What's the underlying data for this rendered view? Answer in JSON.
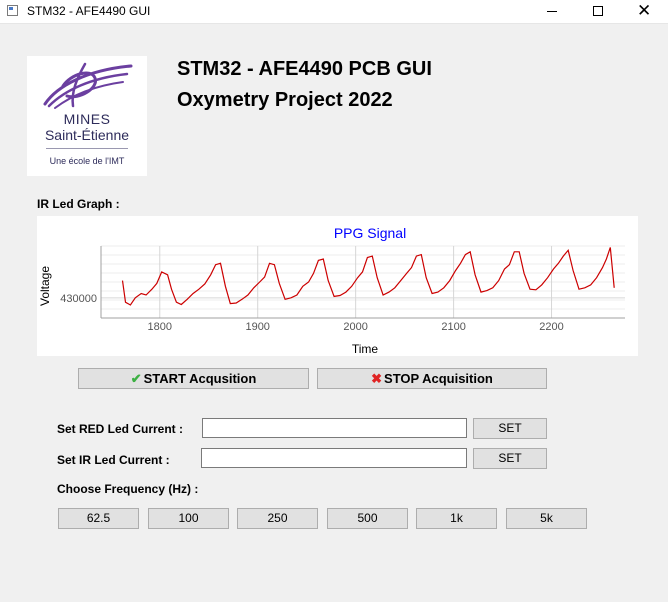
{
  "window": {
    "title": "STM32 - AFE4490 GUI"
  },
  "logo": {
    "line1": "MINES",
    "line2": "Saint-Étienne",
    "line3": "Une école de l'IMT"
  },
  "header": {
    "title_line1": "STM32 - AFE4490 PCB GUI",
    "title_line2": "Oxymetry Project 2022"
  },
  "graph_section": {
    "label": "IR Led Graph :"
  },
  "chart_data": {
    "type": "line",
    "title": "PPG Signal",
    "xlabel": "Time",
    "ylabel": "Voltage",
    "x_ticks": [
      1800,
      1900,
      2000,
      2100,
      2200
    ],
    "y_ticks": [
      430000
    ],
    "xlim": [
      1740,
      2275
    ],
    "ylim": [
      423000,
      448000
    ],
    "grid": true,
    "series": [
      {
        "color": "#cc0000",
        "x": [
          1762,
          1765,
          1770,
          1775,
          1781,
          1786,
          1792,
          1797,
          1802,
          1808,
          1812,
          1817,
          1822,
          1828,
          1834,
          1840,
          1846,
          1852,
          1857,
          1862,
          1867,
          1872,
          1878,
          1884,
          1890,
          1896,
          1902,
          1907,
          1912,
          1917,
          1922,
          1928,
          1934,
          1940,
          1946,
          1952,
          1957,
          1962,
          1967,
          1972,
          1978,
          1984,
          1990,
          1996,
          2002,
          2007,
          2012,
          2017,
          2022,
          2028,
          2034,
          2040,
          2046,
          2052,
          2057,
          2062,
          2067,
          2072,
          2078,
          2084,
          2090,
          2096,
          2102,
          2107,
          2112,
          2117,
          2122,
          2128,
          2134,
          2140,
          2146,
          2152,
          2157,
          2162,
          2167,
          2172,
          2178,
          2184,
          2190,
          2196,
          2202,
          2207,
          2212,
          2217,
          2222,
          2228,
          2234,
          2240,
          2246,
          2252,
          2256,
          2260,
          2264
        ],
        "values": [
          436000,
          428500,
          427500,
          430000,
          431500,
          431000,
          433000,
          435000,
          439000,
          438000,
          433000,
          428500,
          427700,
          429500,
          431500,
          433000,
          434800,
          438000,
          441500,
          442000,
          434000,
          428000,
          428200,
          429500,
          431000,
          433500,
          435500,
          437200,
          442000,
          441500,
          435000,
          429500,
          430000,
          431000,
          434000,
          435500,
          438500,
          443000,
          443500,
          436000,
          430500,
          430800,
          432000,
          434000,
          437000,
          439000,
          444000,
          444500,
          437000,
          431000,
          432000,
          433500,
          436000,
          438500,
          440500,
          444500,
          445000,
          437000,
          431500,
          432000,
          433500,
          436000,
          439500,
          442000,
          445000,
          446000,
          438000,
          432000,
          432500,
          433500,
          436000,
          440000,
          441500,
          446000,
          446000,
          438500,
          433000,
          432800,
          434500,
          437000,
          440000,
          442000,
          444500,
          446500,
          439500,
          433000,
          433500,
          434500,
          437000,
          440500,
          443500,
          447500,
          433500
        ]
      }
    ]
  },
  "acquisition": {
    "start_label": "START Acqusition",
    "stop_label": "STOP Acquisition"
  },
  "red_current": {
    "label": "Set RED Led Current :",
    "value": "",
    "set_label": "SET"
  },
  "ir_current": {
    "label": "Set IR Led Current :",
    "value": "",
    "set_label": "SET"
  },
  "frequency": {
    "label": "Choose Frequency (Hz) :",
    "options": [
      "62.5",
      "100",
      "250",
      "500",
      "1k",
      "5k"
    ]
  }
}
